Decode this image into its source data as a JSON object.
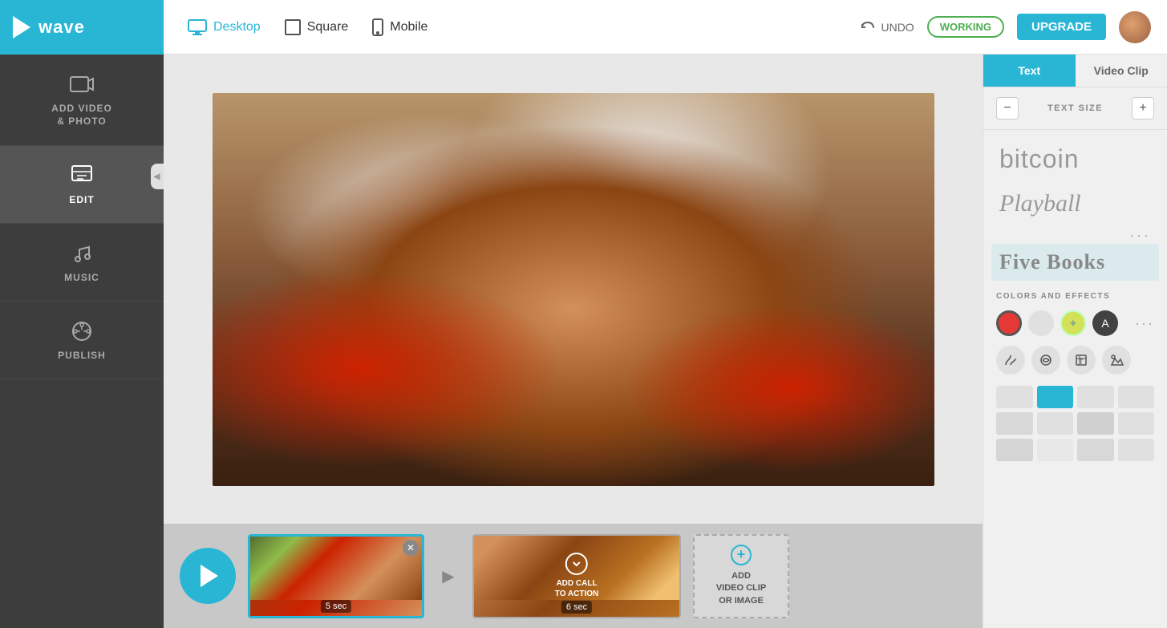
{
  "logo": {
    "text": "wave"
  },
  "topnav": {
    "tabs": [
      {
        "id": "desktop",
        "label": "Desktop",
        "active": true
      },
      {
        "id": "square",
        "label": "Square",
        "active": false
      },
      {
        "id": "mobile",
        "label": "Mobile",
        "active": false
      }
    ],
    "undo_label": "UNDO",
    "working_label": "WORKING",
    "upgrade_label": "UPGRADE"
  },
  "sidebar": {
    "items": [
      {
        "id": "add-video",
        "label": "ADD VIDEO\n& PHOTO",
        "active": false
      },
      {
        "id": "edit",
        "label": "EDIT",
        "active": true
      },
      {
        "id": "music",
        "label": "MUSIC",
        "active": false
      },
      {
        "id": "publish",
        "label": "PUBLISH",
        "active": false
      }
    ]
  },
  "right_panel": {
    "tabs": [
      {
        "id": "text",
        "label": "Text",
        "active": true
      },
      {
        "id": "video-clip",
        "label": "Video Clip",
        "active": false
      }
    ],
    "text_size_label": "TEXT SIZE",
    "font_options": [
      {
        "id": "bitcoin",
        "text": "bitcoin",
        "style": "sans"
      },
      {
        "id": "playball",
        "text": "Playball",
        "style": "italic-serif"
      },
      {
        "id": "five-books",
        "text": "Five Books",
        "style": "bold-serif"
      }
    ],
    "colors_section_label": "COLORS AND EFFECTS",
    "colors": [
      {
        "hex": "#e53935",
        "selected": true
      },
      {
        "hex": "#e0e0e0",
        "selected": false
      },
      {
        "hex": "#d4e157",
        "selected": false
      },
      {
        "hex": "#424242",
        "selected": false
      }
    ],
    "swatches": [
      "#e0e0e0",
      "#29b6d5",
      "#e0e0e0",
      "#e0e0e0",
      "#e0e0e0",
      "#e0e0e0",
      "#e0e0e0",
      "#e0e0e0",
      "#e0e0e0"
    ]
  },
  "timeline": {
    "clips": [
      {
        "id": "clip1",
        "duration": "5 sec",
        "label": "play"
      },
      {
        "id": "clip2",
        "duration": "6 sec",
        "cta": "ADD CALL\nTO ACTION"
      }
    ],
    "add_clip_label": "ADD\nVIDEO CLIP\nOR IMAGE"
  }
}
